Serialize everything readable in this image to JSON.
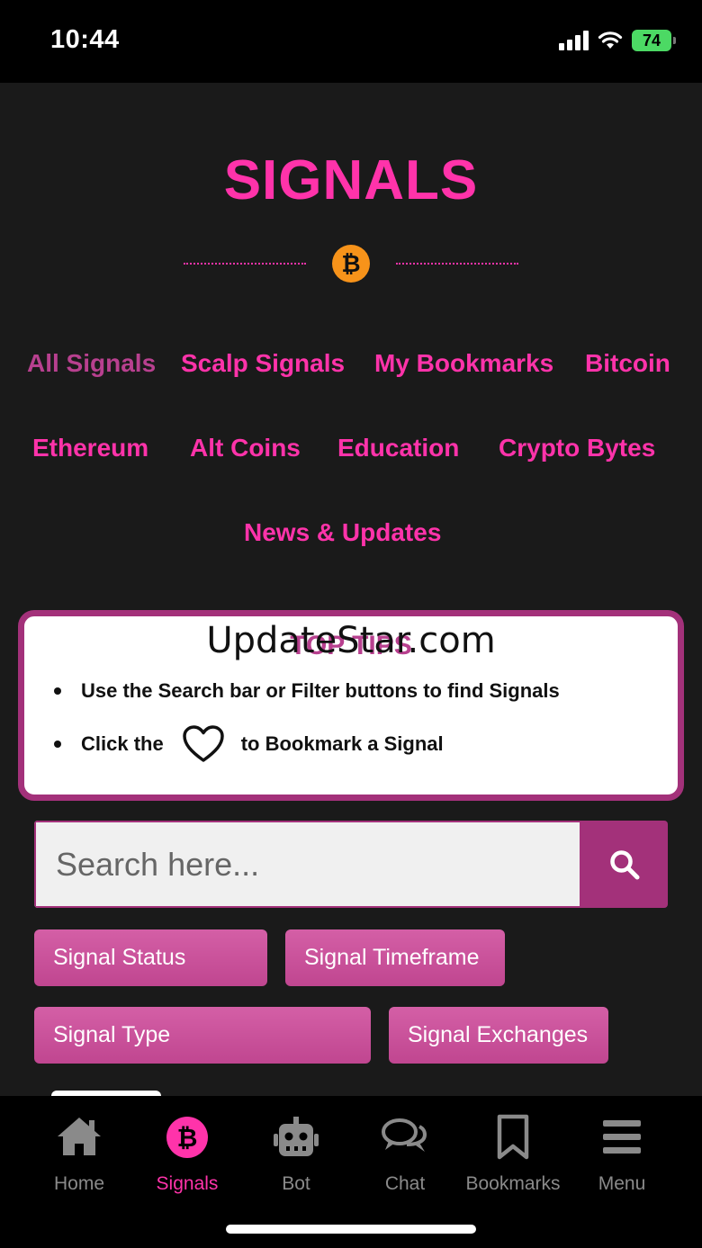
{
  "status_bar": {
    "time": "10:44",
    "battery": "74"
  },
  "header": {
    "title": "SIGNALS",
    "badge_icon": "bitcoin-icon",
    "badge_glyph": "₿"
  },
  "categories": [
    {
      "label": "All Signals",
      "active": true
    },
    {
      "label": "Scalp Signals"
    },
    {
      "label": "My Bookmarks"
    },
    {
      "label": "Bitcoin"
    },
    {
      "label": "Ethereum"
    },
    {
      "label": "Alt Coins"
    },
    {
      "label": "Education"
    },
    {
      "label": "Crypto Bytes"
    },
    {
      "label": "News & Updates"
    }
  ],
  "tips": {
    "title": "TOP TIPS",
    "watermark": "UpdateStar.com",
    "line1": "Use the Search bar or Filter buttons to find Signals",
    "line2_before": "Click the",
    "line2_after": "to Bookmark a Signal"
  },
  "search": {
    "placeholder": "Search here..."
  },
  "filters": {
    "status": "Signal Status",
    "timeframe": "Signal Timeframe",
    "type": "Signal Type",
    "exchanges": "Signal Exchanges"
  },
  "nav": {
    "home": "Home",
    "signals": "Signals",
    "bot": "Bot",
    "chat": "Chat",
    "bookmarks": "Bookmarks",
    "menu": "Menu"
  },
  "colors": {
    "accent": "#ff33aa",
    "accent_dark": "#a3317a",
    "bitcoin": "#f7931a",
    "background": "#1a1a1a"
  }
}
